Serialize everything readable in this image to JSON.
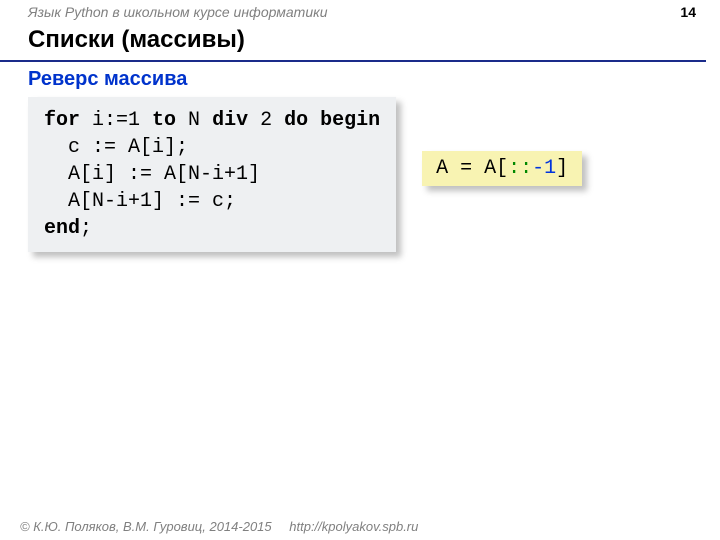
{
  "header": {
    "course_title": "Язык Python в школьном курсе информатики",
    "page_number": "14"
  },
  "title": "Списки (массивы)",
  "subtitle": "Реверс массива",
  "pascal": {
    "l1_for": "for",
    "l1_expr": " i:=1 ",
    "l1_to": "to",
    "l1_expr2": " N ",
    "l1_div": "div",
    "l1_expr3": " 2 ",
    "l1_do": "do begin",
    "l2": "  c := A[i];",
    "l3": "  A[i] := A[N-i+1]",
    "l4": "  A[N-i+1] := c;",
    "l5_end": "end",
    "l5_semi": ";"
  },
  "python": {
    "pre": "A = A[",
    "slice": "::",
    "neg": "-1",
    "post": "]"
  },
  "footer": {
    "copyright": "© К.Ю. Поляков, В.М. Гуровиц, 2014-2015",
    "url": "http://kpolyakov.spb.ru"
  }
}
